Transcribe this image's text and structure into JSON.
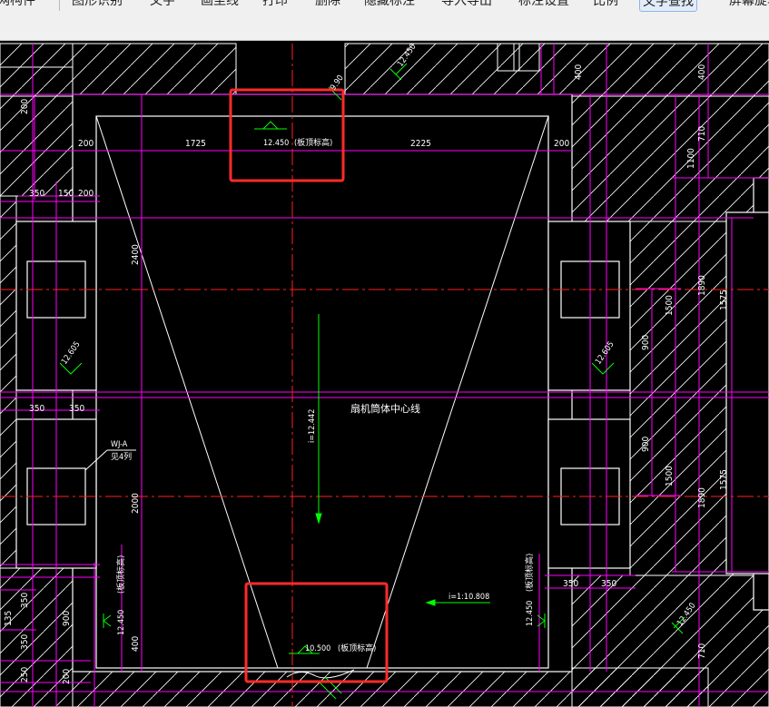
{
  "toolbar": {
    "items": [
      {
        "label": "轴网构件",
        "active": false
      },
      {
        "label": "图形识别",
        "active": false
      },
      {
        "label": "文字",
        "active": false
      },
      {
        "label": "画坐线",
        "active": false
      },
      {
        "label": "打印",
        "active": false
      },
      {
        "label": "删除",
        "active": false
      },
      {
        "label": "隐藏标注",
        "active": false
      },
      {
        "label": "导入导出",
        "active": false
      },
      {
        "label": "标注设置",
        "active": false
      },
      {
        "label": "比例",
        "active": false
      },
      {
        "label": "文字查找",
        "active": true
      },
      {
        "label": "屏幕旋转",
        "active": false
      }
    ]
  },
  "colors": {
    "background": "#000000",
    "wall": "#ffffff",
    "dimension": "#ff00ff",
    "axis": "#ff2020",
    "annotation": "#00ff00",
    "highlight": "#ff2a2a"
  },
  "drawing": {
    "center_label": "扇机筒体中心线",
    "wall_label": {
      "line1": "WJ-A",
      "line2": "见4列"
    },
    "elevation_tag": "(板顶标高)",
    "elevations": {
      "top": "12.450",
      "top_right_small": "12.450",
      "left_small": "12.605",
      "right_small": "12.605",
      "left_bottom": "12.450",
      "right_bottom": "12.450",
      "bottom": "10.500",
      "bottom_right_small": "12.450",
      "top_right_dim": "9.90"
    },
    "slopes": {
      "vertical": "i=12.442",
      "horizontal": "i=1:10.808"
    },
    "dims": {
      "top_left": "200",
      "top_span_left": "1725",
      "top_span_right": "2225",
      "top_right": "200",
      "left_350": "350",
      "left_150": "150",
      "left_200": "200",
      "mid_350_a": "350",
      "mid_350_b": "350",
      "bot_350_a": "350",
      "bot_350_b": "350",
      "v_200_top": "200",
      "v_2400": "2400",
      "v_2000": "2000",
      "v_400": "400",
      "v_900_left": "900",
      "v_350_a": "350",
      "v_350_b": "350",
      "v_250": "250",
      "v_200_bot": "200",
      "v_135": "135",
      "r_400_a": "400",
      "r_400_b": "400",
      "r_710_top": "710",
      "r_1100": "1100",
      "r_1890_top": "1890",
      "r_1575_top": "1575",
      "r_1500_top": "1500",
      "r_900_top": "900",
      "r_900_bot": "900",
      "r_1500_bot": "1500",
      "r_1890_bot": "1890",
      "r_1575_bot": "1575",
      "r_710_bot": "710"
    }
  }
}
